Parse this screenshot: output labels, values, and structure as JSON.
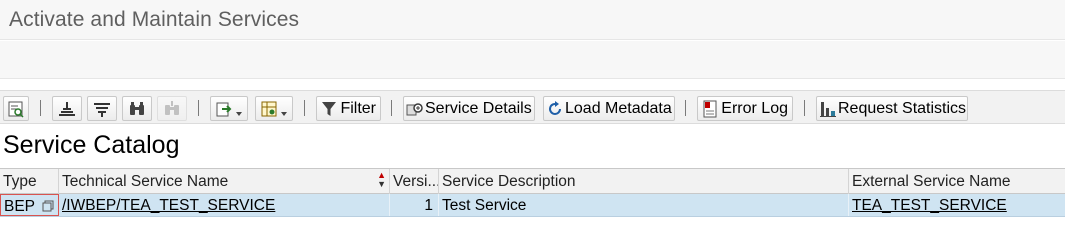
{
  "header": {
    "title": "Activate and Maintain Services"
  },
  "toolbar": {
    "filter_label": "Filter",
    "service_details_label": "Service Details",
    "load_metadata_label": "Load Metadata",
    "error_log_label": "Error Log",
    "request_statistics_label": "Request Statistics"
  },
  "catalog": {
    "title": "Service Catalog",
    "columns": {
      "type": "Type",
      "technical_name": "Technical Service Name",
      "version": "Versi...",
      "description": "Service Description",
      "external_name": "External Service Name"
    },
    "rows": [
      {
        "type": "BEP",
        "technical_name": "/IWBEP/TEA_TEST_SERVICE",
        "version": "1",
        "description": "Test Service",
        "external_name": "TEA_TEST_SERVICE"
      }
    ]
  },
  "colors": {
    "selected_row": "#cfe4f2",
    "toolbar_bg": "#f2f2f2",
    "header_text": "#5f5f5f",
    "error_red": "#c00000"
  }
}
